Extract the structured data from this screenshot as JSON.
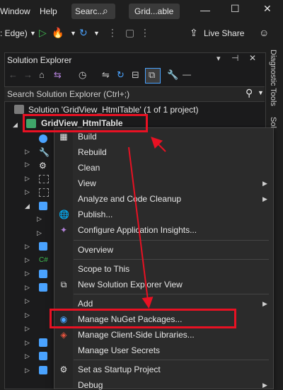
{
  "menubar": {
    "window": "Window",
    "help": "Help",
    "search": "Searc...",
    "solution_short": "Grid...able"
  },
  "toolbar": {
    "debug_target": ": Edge)",
    "live_share": "Live Share"
  },
  "solution_explorer": {
    "title": "Solution Explorer",
    "search_placeholder": "Search Solution Explorer (Ctrl+;)",
    "solution_node": "Solution 'GridView_HtmlTable' (1 of 1 project)",
    "project_node": "GridView_HtmlTable"
  },
  "side_tabs": {
    "diagnostic_tools": "Diagnostic Tools",
    "solution_short": "Sol"
  },
  "context_menu": {
    "items": [
      {
        "label": "Build",
        "icon": "build-icon",
        "submenu": false
      },
      {
        "label": "Rebuild",
        "icon": "",
        "submenu": false
      },
      {
        "label": "Clean",
        "icon": "",
        "submenu": false
      },
      {
        "label": "View",
        "icon": "",
        "submenu": true
      },
      {
        "label": "Analyze and Code Cleanup",
        "icon": "",
        "submenu": true
      },
      {
        "label": "Publish...",
        "icon": "globe-icon",
        "submenu": false
      },
      {
        "label": "Configure Application Insights...",
        "icon": "insights-icon",
        "submenu": false
      },
      {
        "label": "Overview",
        "icon": "",
        "submenu": false
      },
      {
        "label": "Scope to This",
        "icon": "",
        "submenu": false
      },
      {
        "label": "New Solution Explorer View",
        "icon": "new-view-icon",
        "submenu": false
      },
      {
        "label": "Add",
        "icon": "",
        "submenu": true
      },
      {
        "label": "Manage NuGet Packages...",
        "icon": "nuget-icon",
        "submenu": false
      },
      {
        "label": "Manage Client-Side Libraries...",
        "icon": "libman-icon",
        "submenu": false
      },
      {
        "label": "Manage User Secrets",
        "icon": "",
        "submenu": false
      },
      {
        "label": "Set as Startup Project",
        "icon": "gear-icon",
        "submenu": false
      },
      {
        "label": "Debug",
        "icon": "",
        "submenu": true
      }
    ]
  }
}
